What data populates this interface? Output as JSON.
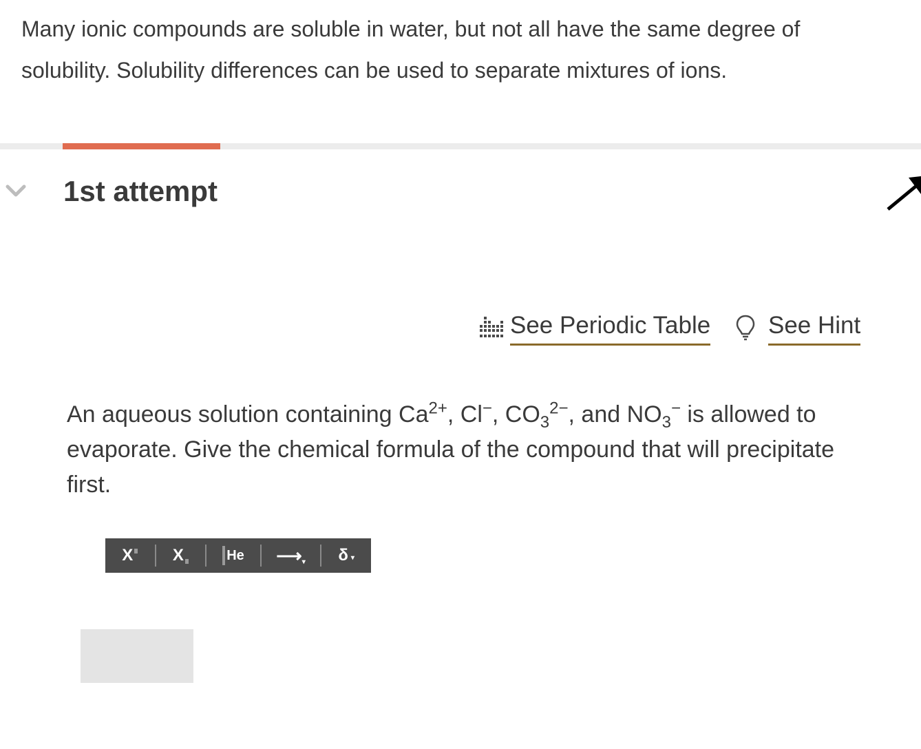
{
  "intro": {
    "text": "Many ionic compounds are soluble in water, but not all have the same degree of solubility. Solubility differences can be used to separate mixtures of ions."
  },
  "progress": {
    "fraction": 0.171,
    "color": "#e06c50",
    "track_color": "#ececec"
  },
  "attempt": {
    "title": "1st attempt"
  },
  "links": {
    "periodic_table": "See Periodic Table",
    "hint": "See Hint",
    "underline_color": "#8a6a2a"
  },
  "question": {
    "p1": "An aqueous solution containing Ca",
    "ca_charge": "2+",
    "p2": ", Cl",
    "cl_charge": "−",
    "p3": ", CO",
    "co3_sub": "3",
    "co3_charge": "2−",
    "p4": ", and NO",
    "no3_sub": "3",
    "no3_charge": "−",
    "p5": " is allowed to evaporate. Give the chemical formula of the compound that will precipitate first."
  },
  "toolbar": {
    "superscript": "X",
    "subscript": "X",
    "element": "He",
    "arrow": "⟶",
    "delta": "δ"
  },
  "answer": {
    "value": ""
  },
  "icons": {
    "collapse": "chevron-down-icon",
    "corner": "arrow-up-right-icon",
    "periodic_table": "periodic-table-icon",
    "hint": "lightbulb-icon"
  }
}
